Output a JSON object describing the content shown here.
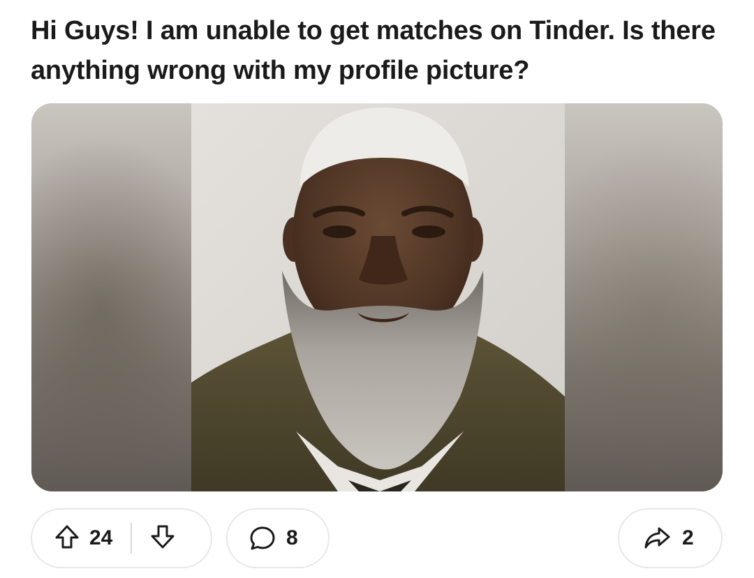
{
  "post": {
    "title": "Hi Guys! I am unable to get matches on Tinder. Is there anything wrong with my profile picture?"
  },
  "actions": {
    "upvote_count": "24",
    "comment_count": "8",
    "share_count": "2"
  },
  "icons": {
    "upvote": "arrow-up-icon",
    "downvote": "arrow-down-icon",
    "comment": "speech-bubble-icon",
    "share": "share-arrow-icon"
  },
  "colors": {
    "text": "#1a1a1b",
    "pill_border": "#e7e8ea",
    "background": "#ffffff"
  }
}
